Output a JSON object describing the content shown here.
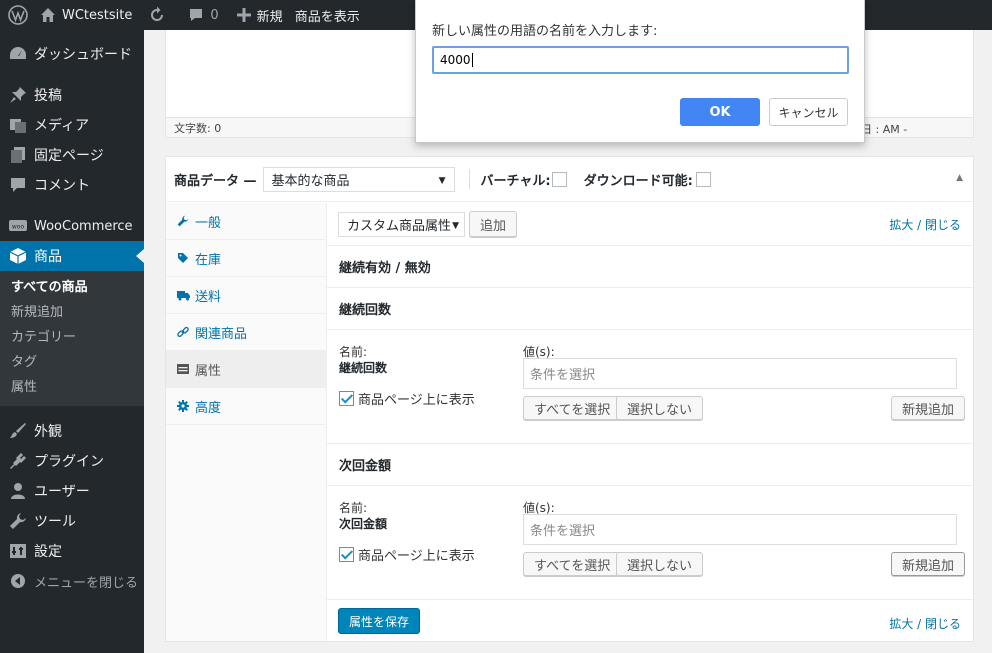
{
  "adminbar": {
    "site_name": "WCtestsite",
    "comments_count": "0",
    "new_label": "新規",
    "view_product": "商品を表示"
  },
  "sidebar": {
    "items": [
      {
        "label": "ダッシュボード",
        "icon": "dashboard-icon"
      },
      {
        "label": "投稿",
        "icon": "pin-icon"
      },
      {
        "label": "メディア",
        "icon": "media-icon"
      },
      {
        "label": "固定ページ",
        "icon": "page-icon"
      },
      {
        "label": "コメント",
        "icon": "comment-icon"
      },
      {
        "label": "WooCommerce",
        "icon": "woo-icon"
      },
      {
        "label": "商品",
        "icon": "product-box-icon"
      }
    ],
    "submenu": [
      "すべての商品",
      "新規追加",
      "カテゴリー",
      "タグ",
      "属性"
    ],
    "items2": [
      {
        "label": "外観",
        "icon": "brush-icon"
      },
      {
        "label": "プラグイン",
        "icon": "plugin-icon"
      },
      {
        "label": "ユーザー",
        "icon": "user-icon"
      },
      {
        "label": "ツール",
        "icon": "wrench-icon"
      },
      {
        "label": "設定",
        "icon": "settings-icon"
      }
    ],
    "collapse": "メニューを閉じる"
  },
  "editor": {
    "word_count": "文字数: 0",
    "status_right": "日 :   AM -"
  },
  "product_data": {
    "title": "商品データ —",
    "type_value": "基本的な商品",
    "virtual_label": "バーチャル:",
    "download_label": "ダウンロード可能:",
    "tabs": [
      "一般",
      "在庫",
      "送料",
      "関連商品",
      "属性",
      "高度"
    ],
    "attr_select": "カスタム商品属性",
    "add_button": "追加",
    "expand_close": "拡大 / 閉じる",
    "attr_sections": [
      {
        "title": "継続有効 / 無効"
      },
      {
        "title": "継続回数",
        "name_label": "名前:",
        "name_value": "継続回数",
        "values_label": "値(s):",
        "values_placeholder": "条件を選択",
        "show_label": "商品ページ上に表示",
        "select_all": "すべてを選択",
        "select_none": "選択しない",
        "add_new": "新規追加"
      },
      {
        "title": "次回金額",
        "name_label": "名前:",
        "name_value": "次回金額",
        "values_label": "値(s):",
        "values_placeholder": "条件を選択",
        "show_label": "商品ページ上に表示",
        "select_all": "すべてを選択",
        "select_none": "選択しない",
        "add_new": "新規追加"
      }
    ],
    "save_button": "属性を保存"
  },
  "dialog": {
    "message": "新しい属性の用語の名前を入力します:",
    "input_value": "4000",
    "ok": "OK",
    "cancel": "キャンセル"
  },
  "colors": {
    "admin_dark": "#23282d",
    "accent": "#0073aa",
    "primary_button": "#0085ba",
    "dialog_ok": "#4285f4"
  }
}
